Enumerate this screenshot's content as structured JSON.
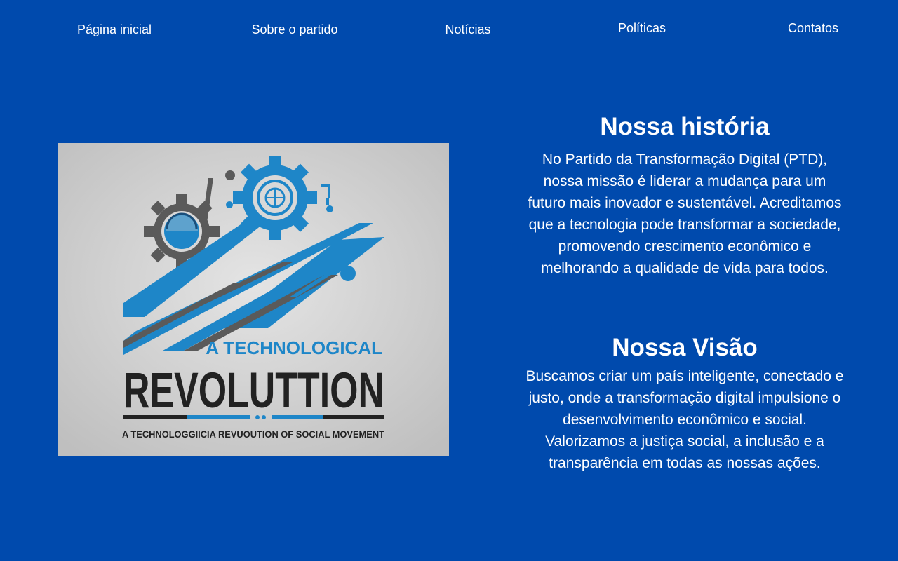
{
  "nav": {
    "items": [
      {
        "label": "Página inicial"
      },
      {
        "label": "Sobre o partido"
      },
      {
        "label": "Notícias"
      },
      {
        "label": "Políticas"
      },
      {
        "label": "Contatos"
      }
    ]
  },
  "hero": {
    "logo_text": {
      "line1": "A TECHNOLOGICAL",
      "line2": "REVOLUTTION",
      "tagline": "A TECHNOLOGGIICIA REVUOUTION OF SOCIAL MOVEMENT"
    },
    "colors": {
      "background": "#d2d2d2",
      "blue": "#1e86c8",
      "dark": "#5a5a5a",
      "text_dark": "#222222"
    }
  },
  "history": {
    "title": "Nossa história",
    "body": "No Partido da Transformação Digital (PTD), nossa missão é liderar a mudança para um futuro mais inovador e sustentável. Acreditamos que a tecnologia pode transformar a sociedade, promovendo crescimento econômico e melhorando a qualidade de vida para todos."
  },
  "vision": {
    "title": "Nossa Visão",
    "body": "Buscamos criar um país inteligente, conectado e justo, onde a transformação digital impulsione o desenvolvimento econômico e social. Valorizamos a justiça social, a inclusão e a transparência em todas as nossas ações."
  },
  "theme": {
    "page_background": "#004aad",
    "text": "#ffffff"
  }
}
